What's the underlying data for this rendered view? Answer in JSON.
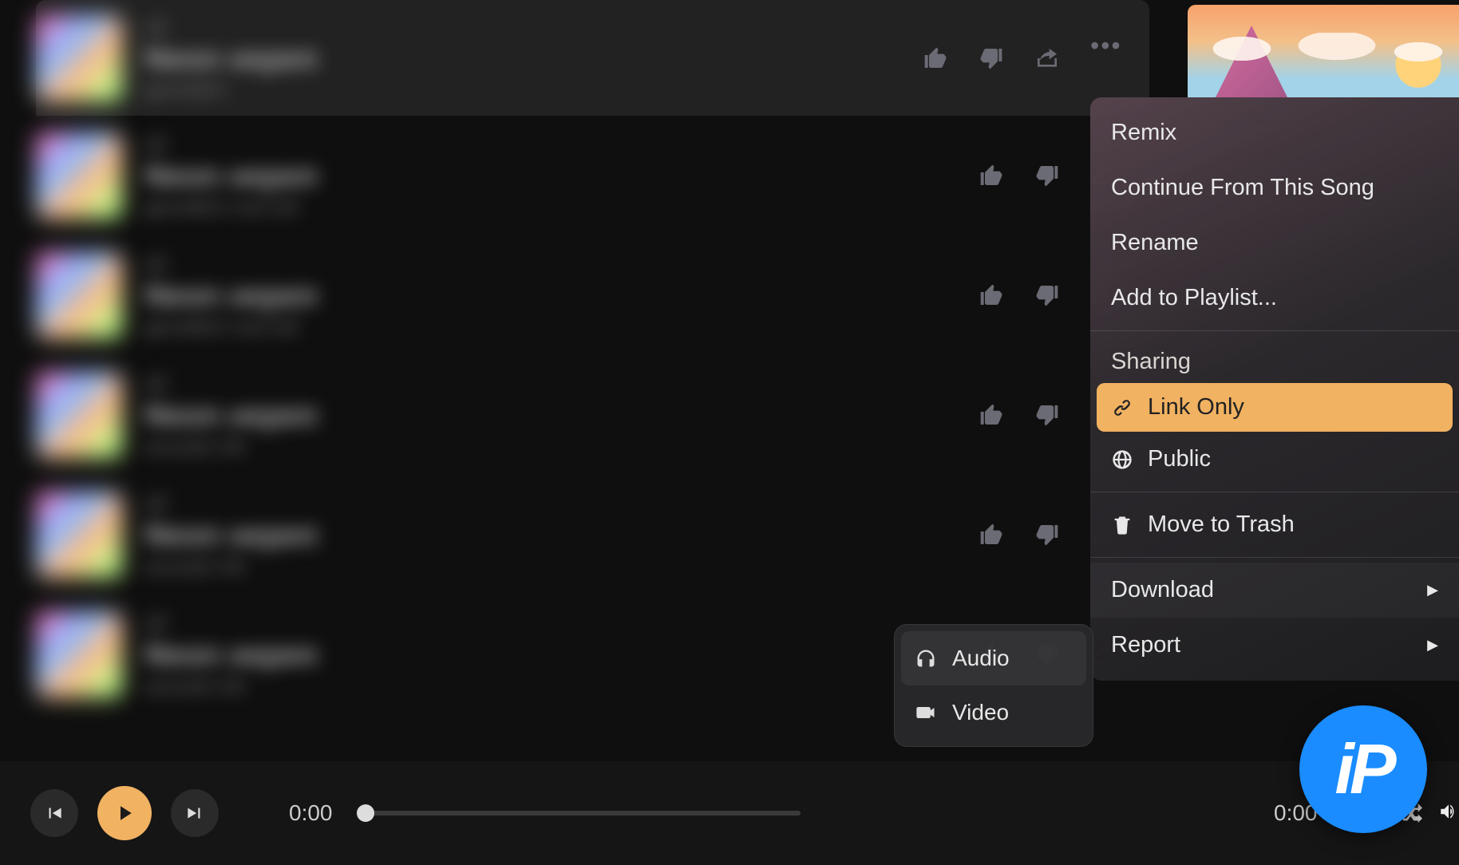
{
  "tracks": [
    {
      "line1": "v2",
      "line2": "Neon нереп",
      "line3": "gemütlich"
    },
    {
      "line1": "v2",
      "line2": "Neon нереп",
      "line3": "gemütlich rock lofi"
    },
    {
      "line1": "v2",
      "line2": "Neon нереп",
      "line3": "gemütlich rock lofi"
    },
    {
      "line1": "v2",
      "line2": "Neon нереп",
      "line3": "acoustic lofi"
    },
    {
      "line1": "v2",
      "line2": "Neon нереп",
      "line3": "acoustic lofi"
    },
    {
      "line1": "v2",
      "line2": "Neon нереп",
      "line3": "acoustic lofi"
    }
  ],
  "menu": {
    "remix": "Remix",
    "continue": "Continue From This Song",
    "rename": "Rename",
    "add_playlist": "Add to Playlist...",
    "sharing_header": "Sharing",
    "link_only": "Link Only",
    "public": "Public",
    "trash": "Move to Trash",
    "download": "Download",
    "report": "Report"
  },
  "submenu": {
    "audio": "Audio",
    "video": "Video"
  },
  "player": {
    "elapsed": "0:00",
    "remaining": "0:00"
  },
  "badge": "iP",
  "colors": {
    "accent": "#f1b262",
    "blue": "#1a8cff"
  }
}
